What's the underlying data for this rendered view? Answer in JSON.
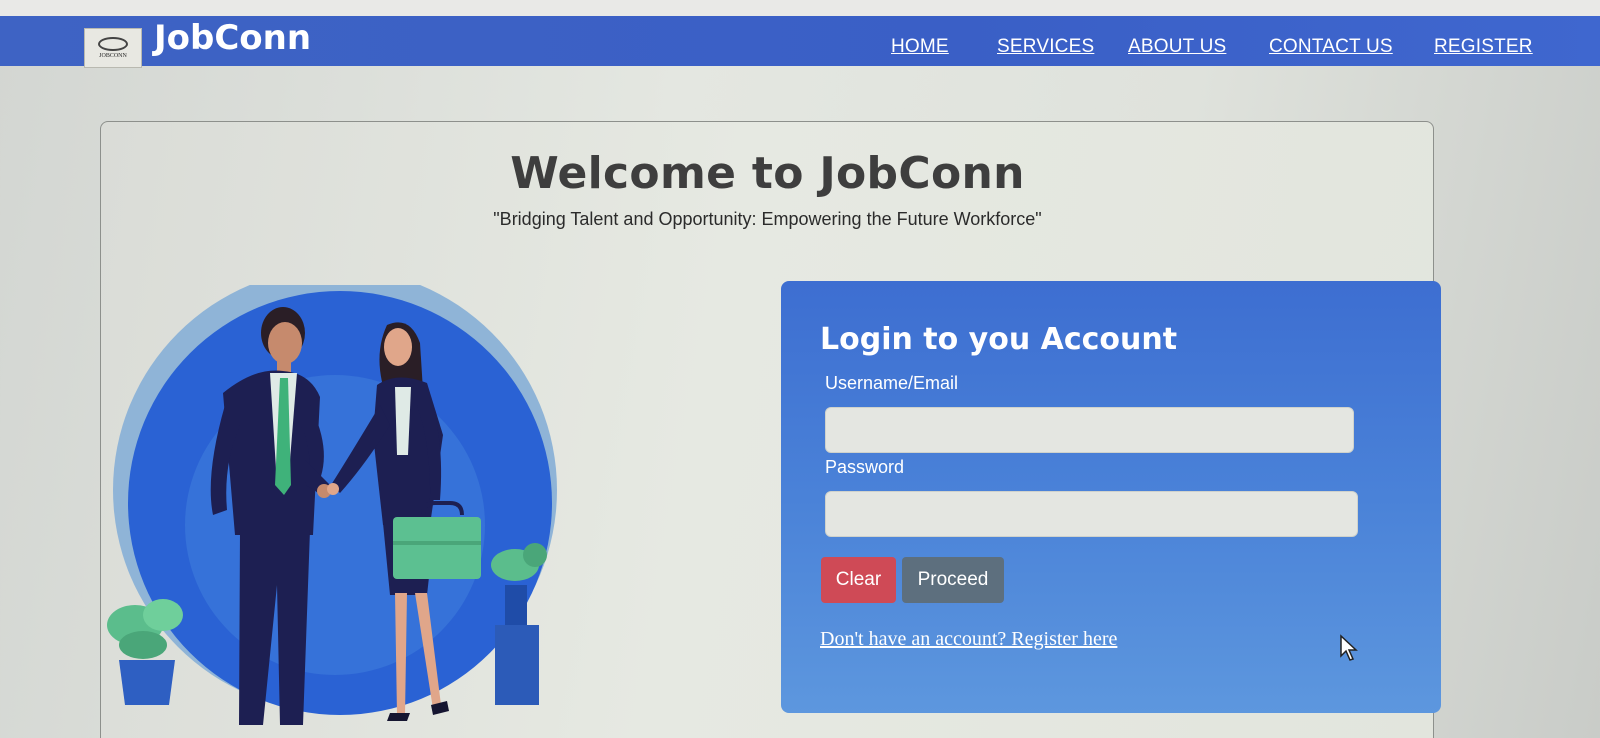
{
  "header": {
    "brand": "JobConn",
    "logo_text": "JOBCONN",
    "nav": [
      {
        "label": "HOME"
      },
      {
        "label": "SERVICES"
      },
      {
        "label": "ABOUT US"
      },
      {
        "label": "CONTACT US"
      },
      {
        "label": "REGISTER"
      }
    ]
  },
  "main": {
    "title": "Welcome to JobConn",
    "tagline": "\"Bridging Talent and Opportunity: Empowering the Future Workforce\""
  },
  "login": {
    "heading": "Login to you Account",
    "username_label": "Username/Email",
    "username_value": "",
    "password_label": "Password",
    "password_value": "",
    "clear_label": "Clear",
    "proceed_label": "Proceed",
    "register_link": "Don't have an account? Register here"
  },
  "colors": {
    "navbar": "#3a5fc6",
    "login_panel": "#4a82d8",
    "clear_button": "#cf4a56",
    "proceed_button": "#5d6f7e"
  },
  "icons": [
    "logo-emblem-icon",
    "handshake-illustration",
    "briefcase-icon",
    "plant-icon",
    "mouse-pointer-icon"
  ]
}
